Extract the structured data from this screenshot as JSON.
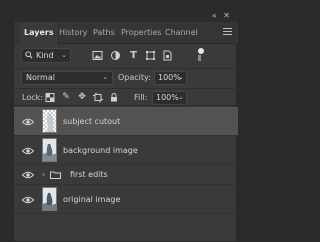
{
  "header": {
    "collapse_icon_text": "«"
  },
  "tabs": [
    {
      "label": "Layers",
      "active": true
    },
    {
      "label": "History"
    },
    {
      "label": "Paths"
    },
    {
      "label": "Properties"
    },
    {
      "label": "Channel"
    }
  ],
  "filter": {
    "kind_label": "Kind"
  },
  "blend": {
    "mode": "Normal",
    "opacity_label": "Opacity:",
    "opacity_value": "100%"
  },
  "lock": {
    "label": "Lock:",
    "fill_label": "Fill:",
    "fill_value": "100%"
  },
  "layers": [
    {
      "name": "subject cutout",
      "selected": true,
      "thumbnail": "transparent-cutout"
    },
    {
      "name": "background image",
      "thumbnail": "photo"
    },
    {
      "name": "first edits",
      "type": "group",
      "expanded": false
    },
    {
      "name": "original image",
      "thumbnail": "photo"
    }
  ],
  "colors": {
    "panel_bg": "#3a3a3a",
    "selected_layer_bg": "#525252",
    "text": "#d6d6d6"
  }
}
